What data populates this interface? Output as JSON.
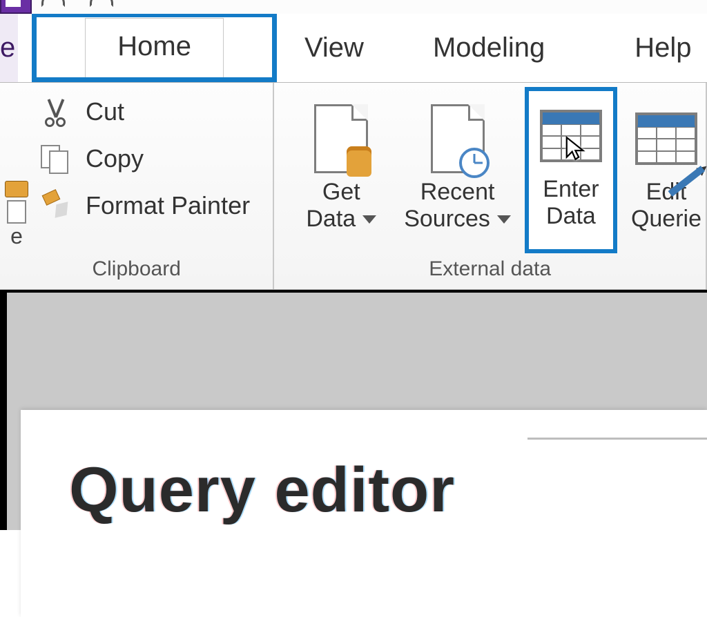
{
  "tabs": {
    "home": "Home",
    "view": "View",
    "modeling": "Modeling",
    "help": "Help",
    "file_fragment": "e"
  },
  "clipboard": {
    "group_label": "Clipboard",
    "cut": "Cut",
    "copy": "Copy",
    "format_painter": "Format Painter",
    "paste_fragment": "e"
  },
  "external": {
    "group_label": "External data",
    "get_data_l1": "Get",
    "get_data_l2": "Data",
    "recent_l1": "Recent",
    "recent_l2": "Sources",
    "enter_l1": "Enter",
    "enter_l2": "Data",
    "edit_l1": "Edit",
    "edit_l2": "Querie"
  },
  "document": {
    "title": "Query editor"
  },
  "highlight": {
    "tab": "home",
    "button": "enter-data"
  },
  "colors": {
    "highlight": "#137bc7",
    "accent": "#3a78b5",
    "warm": "#e3a23a"
  }
}
